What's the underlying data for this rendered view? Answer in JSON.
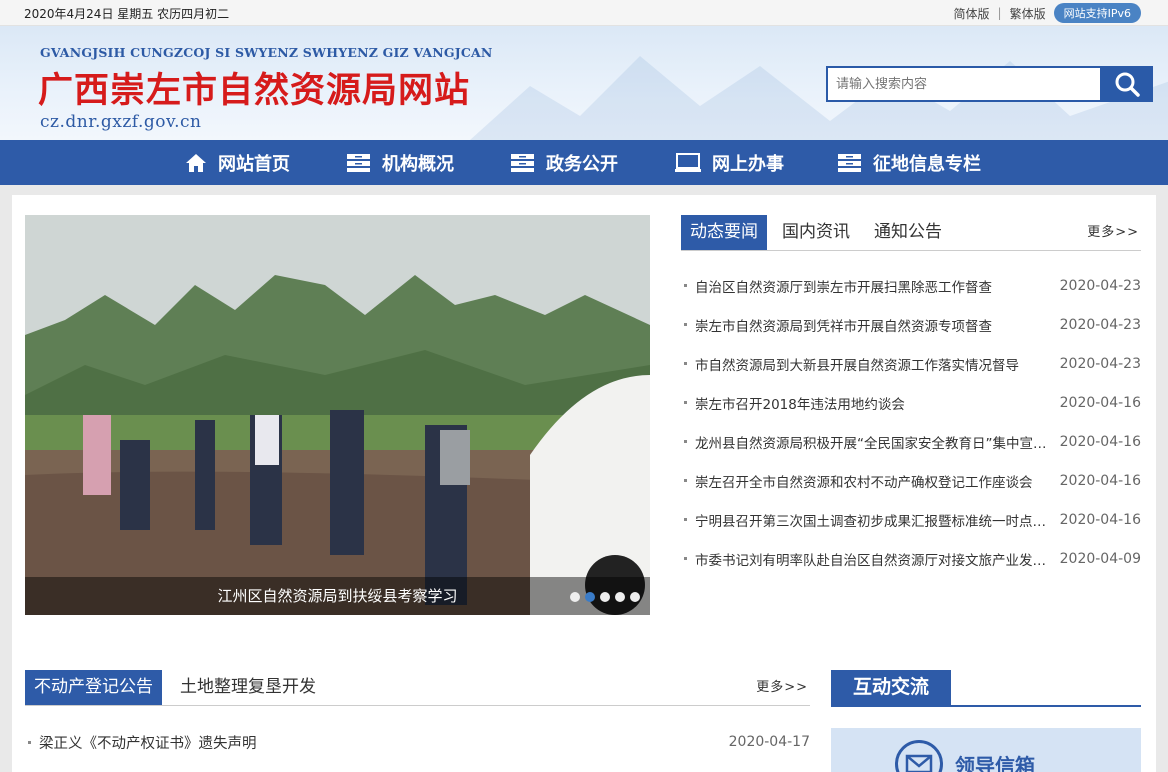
{
  "topbar": {
    "date": "2020年4月24日 星期五 农历四月初二",
    "simplified": "简体版",
    "separator": "|",
    "traditional": "繁体版",
    "ipv6": "网站支持IPv6"
  },
  "header": {
    "pinyin": "GVANGJSIH CUNGZCOJ SI SWYENZ SWHYENZ GIZ VANGJCAN",
    "title": "广西崇左市自然资源局网站",
    "domain": "cz.dnr.gxzf.gov.cn"
  },
  "search": {
    "placeholder": "请输入搜索内容",
    "icon": "search-icon"
  },
  "nav": {
    "items": [
      {
        "label": "网站首页",
        "icon": "home-icon"
      },
      {
        "label": "机构概况",
        "icon": "drawer-icon"
      },
      {
        "label": "政务公开",
        "icon": "drawer-icon"
      },
      {
        "label": "网上办事",
        "icon": "monitor-icon"
      },
      {
        "label": "征地信息专栏",
        "icon": "drawer-icon"
      }
    ]
  },
  "slider": {
    "caption": "江州区自然资源局到扶绥县考察学习",
    "dots": 5,
    "active_dot": 2
  },
  "news": {
    "tabs": [
      "动态要闻",
      "国内资讯",
      "通知公告"
    ],
    "more": "更多>>",
    "items": [
      {
        "title": "自治区自然资源厅到崇左市开展扫黑除恶工作督查",
        "date": "2020-04-23"
      },
      {
        "title": "崇左市自然资源局到凭祥市开展自然资源专项督查",
        "date": "2020-04-23"
      },
      {
        "title": "市自然资源局到大新县开展自然资源工作落实情况督导",
        "date": "2020-04-23"
      },
      {
        "title": "崇左市召开2018年违法用地约谈会",
        "date": "2020-04-16"
      },
      {
        "title": "龙州县自然资源局积极开展“全民国家安全教育日”集中宣传活动",
        "date": "2020-04-16"
      },
      {
        "title": "崇左召开全市自然资源和农村不动产确权登记工作座谈会",
        "date": "2020-04-16"
      },
      {
        "title": "宁明县召开第三次国土调查初步成果汇报暨标准统一时点工作会",
        "date": "2020-04-16"
      },
      {
        "title": "市委书记刘有明率队赴自治区自然资源厅对接文旅产业发展工作",
        "date": "2020-04-09"
      }
    ]
  },
  "realestate": {
    "tabs": [
      "不动产登记公告",
      "土地整理复垦开发"
    ],
    "more": "更多>>",
    "items": [
      {
        "title": "梁正义《不动产权证书》遗失声明",
        "date": "2020-04-17"
      }
    ]
  },
  "interaction": {
    "title": "互动交流",
    "mailbox_label": "领导信箱",
    "mailbox_icon": "mail-icon"
  },
  "colors": {
    "primary": "#2e5ba8",
    "title_red": "#d61b1b",
    "accent_dot": "#3a7cc8"
  }
}
